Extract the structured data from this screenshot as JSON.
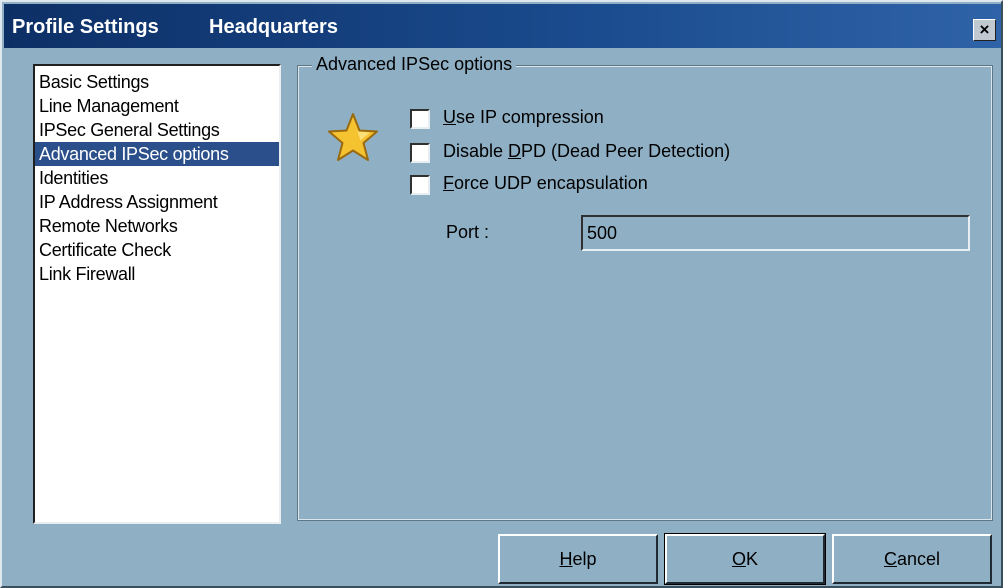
{
  "window": {
    "title": "Profile Settings",
    "subtitle": "Headquarters",
    "close_label": "×"
  },
  "sidebar": {
    "items": [
      {
        "label": "Basic Settings",
        "selected": false
      },
      {
        "label": "Line Management",
        "selected": false
      },
      {
        "label": "IPSec General Settings",
        "selected": false
      },
      {
        "label": "Advanced IPSec options",
        "selected": true
      },
      {
        "label": "Identities",
        "selected": false
      },
      {
        "label": "IP Address Assignment",
        "selected": false
      },
      {
        "label": "Remote Networks",
        "selected": false
      },
      {
        "label": "Certificate Check",
        "selected": false
      },
      {
        "label": "Link Firewall",
        "selected": false
      }
    ]
  },
  "panel": {
    "title": "Advanced IPSec options",
    "icon": "star-icon",
    "options": [
      {
        "pre": "",
        "key": "U",
        "post": "se IP compression",
        "checked": false
      },
      {
        "pre": "Disable ",
        "key": "D",
        "post": "PD (Dead Peer Detection)",
        "checked": false
      },
      {
        "pre": "",
        "key": "F",
        "post": "orce UDP encapsulation",
        "checked": false
      }
    ],
    "port": {
      "label": "Port :",
      "value": "500"
    }
  },
  "buttons": {
    "help": {
      "key": "H",
      "rest": "elp"
    },
    "ok": {
      "key": "O",
      "rest": "K"
    },
    "cancel": {
      "key": "C",
      "rest": "ancel"
    }
  },
  "colors": {
    "dialog_bg": "#8fafc4",
    "titlebar": "#0d2f66",
    "selection": "#2b4f8a",
    "star_fill": "#f5c230"
  }
}
